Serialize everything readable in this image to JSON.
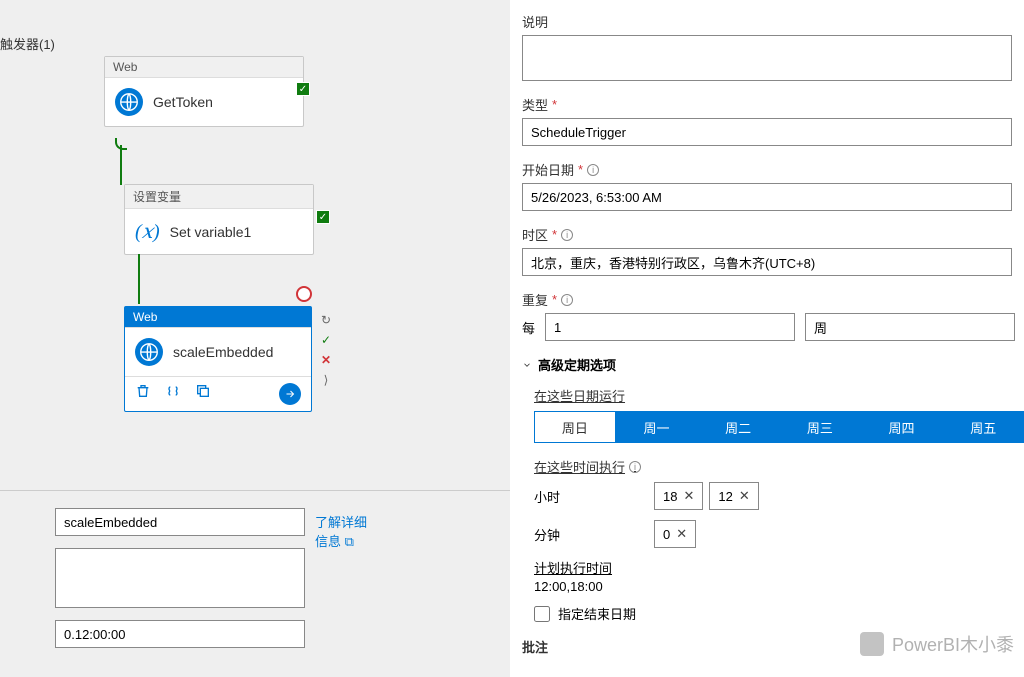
{
  "leftPane": {
    "triggerLabel": "触发器(1)",
    "nodes": {
      "getToken": {
        "header": "Web",
        "title": "GetToken"
      },
      "setVar": {
        "header": "设置变量",
        "title": "Set variable1"
      },
      "scaleEmbedded": {
        "header": "Web",
        "title": "scaleEmbedded"
      }
    },
    "bottom": {
      "nameValue": "scaleEmbedded",
      "learnMore": "了解详细信息",
      "timeValue": "0.12:00:00"
    }
  },
  "rightPane": {
    "description": {
      "label": "说明"
    },
    "type": {
      "label": "类型",
      "value": "ScheduleTrigger"
    },
    "startDate": {
      "label": "开始日期",
      "value": "5/26/2023, 6:53:00 AM"
    },
    "timezone": {
      "label": "时区",
      "value": "北京，重庆，香港特别行政区，乌鲁木齐(UTC+8)"
    },
    "repeat": {
      "label": "重复",
      "every": "每",
      "num": "1",
      "unit": "周"
    },
    "advanced": {
      "header": "高级定期选项",
      "runOnDays": "在这些日期运行",
      "days": [
        "周日",
        "周一",
        "周二",
        "周三",
        "周四",
        "周五"
      ],
      "selectedDays": [
        1,
        2,
        3,
        4,
        5
      ],
      "runOnTimes": "在这些时间执行",
      "hoursLabel": "小时",
      "hours": [
        "18",
        "12"
      ],
      "minutesLabel": "分钟",
      "minutes": [
        "0"
      ],
      "planLabel": "计划执行时间",
      "planValue": "12:00,18:00",
      "endDateLabel": "指定结束日期"
    },
    "notes": {
      "label": "批注"
    }
  },
  "watermark": "PowerBI木小黍"
}
